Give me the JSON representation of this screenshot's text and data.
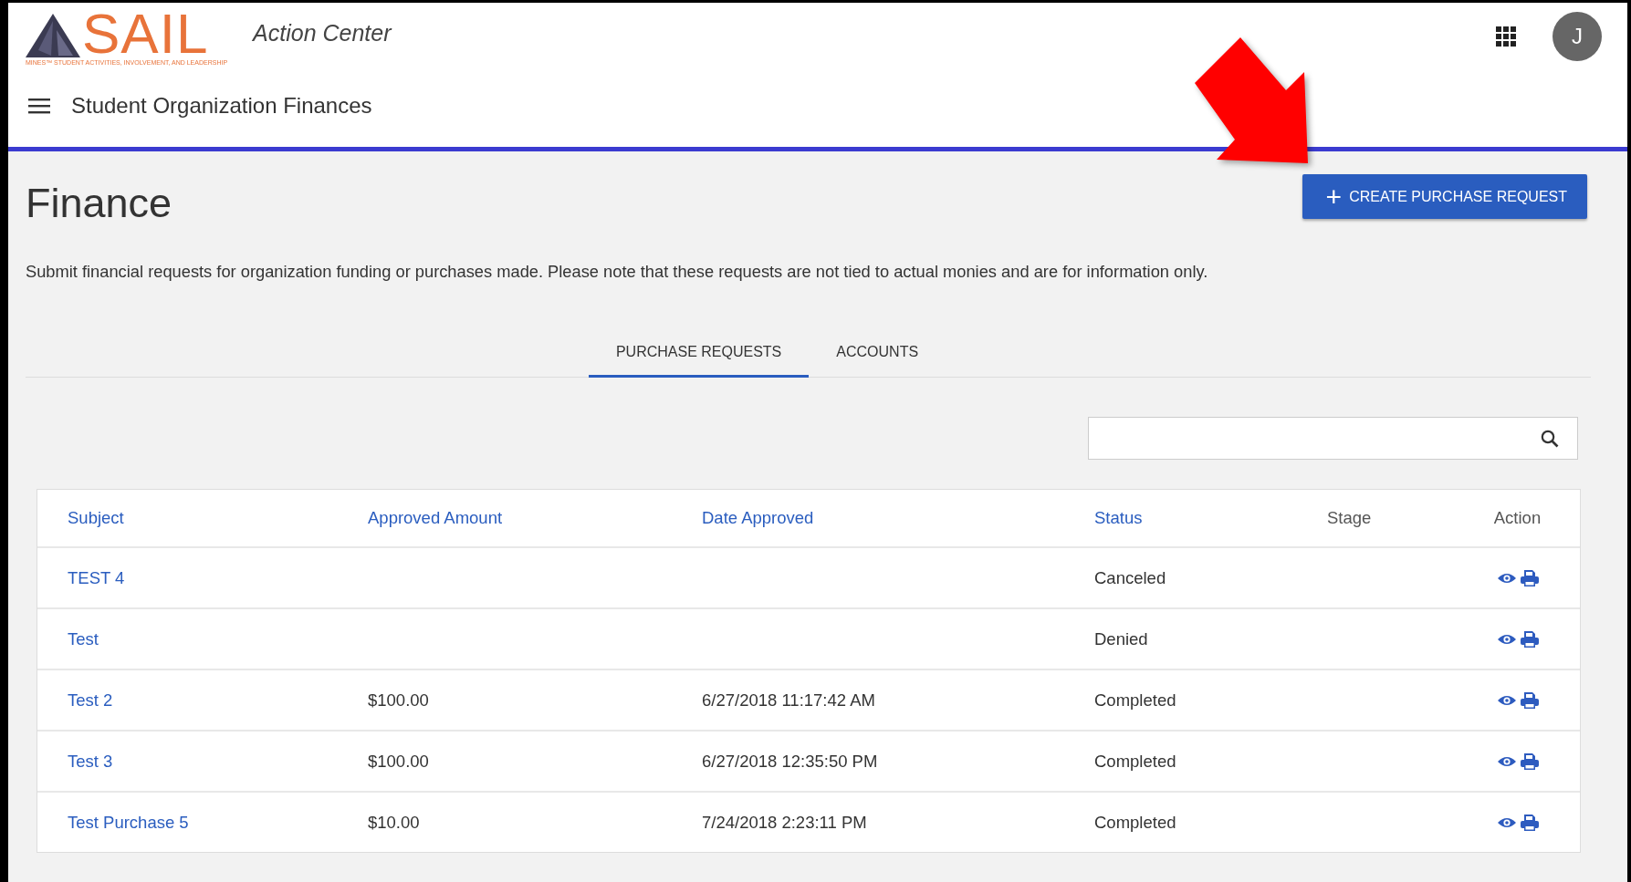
{
  "header": {
    "logo": {
      "text": "SAIL",
      "tagline": "MINES™ STUDENT ACTIVITIES, INVOLVEMENT, AND LEADERSHIP"
    },
    "app_title": "Action Center",
    "section_title": "Student Organization Finances",
    "avatar": "J"
  },
  "page": {
    "title": "Finance",
    "button": {
      "icon": "+",
      "label": "CREATE PURCHASE REQUEST"
    },
    "description": "Submit financial requests for organization funding or purchases made. Please note that these requests are not tied to actual monies and are for information only."
  },
  "tabs": [
    {
      "label": "PURCHASE REQUESTS",
      "selected": true
    },
    {
      "label": "ACCOUNTS",
      "selected": false
    }
  ],
  "table": {
    "columns": [
      {
        "label": "Subject",
        "sortable": true
      },
      {
        "label": "Approved Amount",
        "sortable": true
      },
      {
        "label": "Date Approved",
        "sortable": true
      },
      {
        "label": "Status",
        "sortable": true
      },
      {
        "label": "Stage",
        "sortable": false
      },
      {
        "label": "Action",
        "sortable": false
      }
    ],
    "rows": [
      {
        "subject": "TEST 4",
        "status": "Canceled"
      },
      {
        "subject": "Test",
        "status": "Denied"
      },
      {
        "subject": "Test 2",
        "approved_amount": "$100.00",
        "date_approved": "6/27/2018 11:17:42 AM",
        "status": "Completed"
      },
      {
        "subject": "Test 3",
        "approved_amount": "$100.00",
        "date_approved": "6/27/2018 12:35:50 PM",
        "status": "Completed"
      },
      {
        "subject": "Test Purchase 5",
        "approved_amount": "$10.00",
        "date_approved": "7/24/2018 2:23:11 PM",
        "status": "Completed"
      }
    ]
  }
}
